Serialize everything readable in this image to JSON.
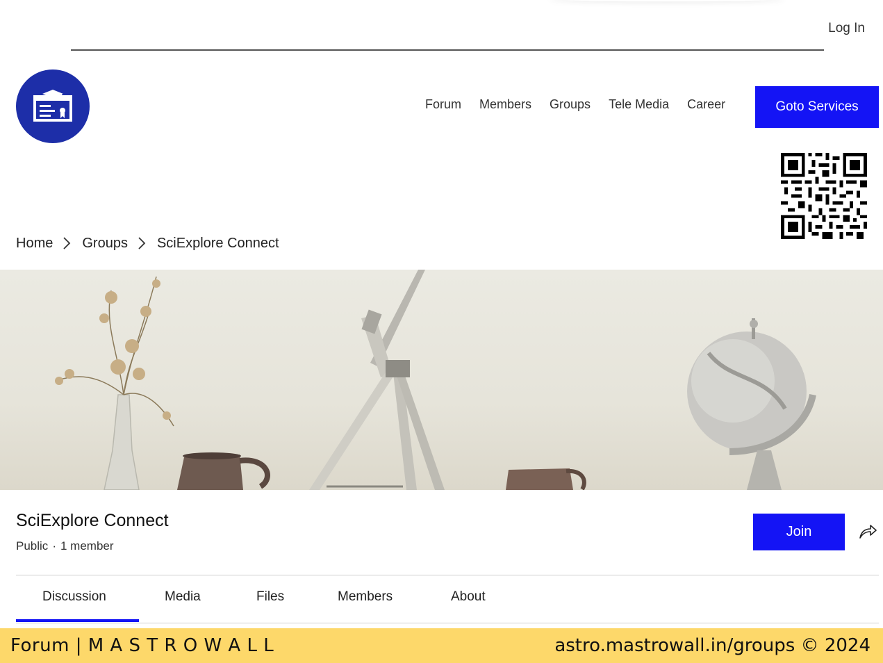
{
  "header": {
    "login_label": "Log In"
  },
  "nav": {
    "items": [
      "Forum",
      "Members",
      "Groups",
      "Tele Media",
      "Career"
    ],
    "cta_label": "Goto Services"
  },
  "breadcrumb": {
    "items": [
      "Home",
      "Groups",
      "SciExplore Connect"
    ]
  },
  "group": {
    "title": "SciExplore Connect",
    "privacy": "Public",
    "separator": "·",
    "members": "1 member",
    "join_label": "Join"
  },
  "tabs": [
    "Discussion",
    "Media",
    "Files",
    "Members",
    "About"
  ],
  "active_tab": "Discussion",
  "footer": {
    "left": "Forum | M A S T R O W A L L",
    "right": "astro.mastrowall.in/groups  © 2024"
  },
  "colors": {
    "accent": "#1414f5",
    "logo_bg": "#1d2ea8",
    "footer_bg": "#fdd86a"
  },
  "icons": [
    "graduation-certificate-icon",
    "chevron-right-icon",
    "share-arrow-icon",
    "qr-code"
  ]
}
